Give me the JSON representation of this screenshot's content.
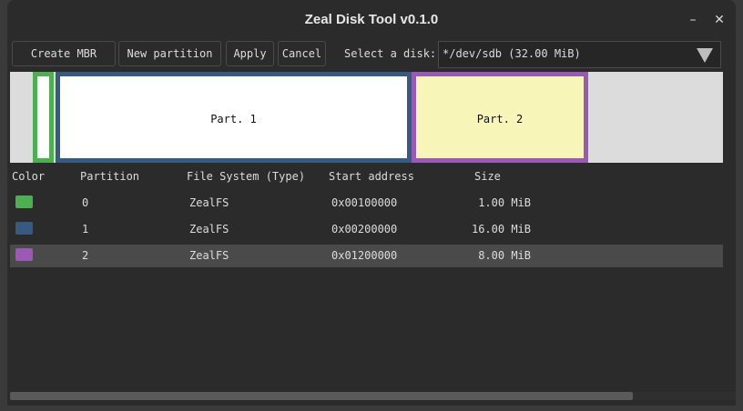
{
  "window": {
    "title": "Zeal Disk Tool v0.1.0",
    "minimize_glyph": "–",
    "close_glyph": "✕"
  },
  "toolbar": {
    "create_mbr_label": "Create MBR",
    "new_partition_label": "New partition",
    "apply_label": "Apply",
    "cancel_label": "Cancel",
    "select_disk_label": "Select a disk:",
    "selected_disk": "*/dev/sdb (32.00 MiB)"
  },
  "disk_map": {
    "partitions": [
      {
        "label": "",
        "color": "#4caf50",
        "fill": "#ffffff"
      },
      {
        "label": "Part. 1",
        "color": "#365a80",
        "fill": "#ffffff"
      },
      {
        "label": "Part. 2",
        "color": "#9b59b6",
        "fill": "#f7f5b8"
      }
    ],
    "unused_color": "#dcdcdc"
  },
  "table": {
    "headers": [
      "Color",
      "Partition",
      "File System (Type)",
      "Start address",
      "Size"
    ],
    "rows": [
      {
        "color": "#4caf50",
        "partition": "0",
        "fs": "ZealFS",
        "start": "0x00100000",
        "size": "1.00 MiB"
      },
      {
        "color": "#365a80",
        "partition": "1",
        "fs": "ZealFS",
        "start": "0x00200000",
        "size": "16.00 MiB"
      },
      {
        "color": "#9b59b6",
        "partition": "2",
        "fs": "ZealFS",
        "start": "0x01200000",
        "size": "8.00 MiB",
        "selected": true
      }
    ]
  }
}
